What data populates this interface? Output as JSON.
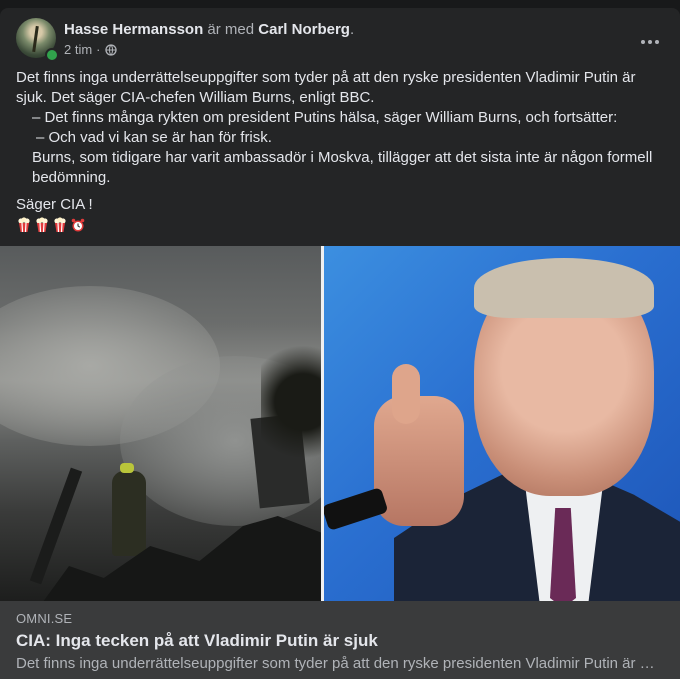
{
  "post": {
    "author": "Hasse Hermansson",
    "with_text": "är med",
    "tagged": "Carl Norberg",
    "tagged_suffix": ".",
    "time": "2 tim",
    "time_sep": "·",
    "privacy_icon": "globe-icon",
    "menu_icon": "more-options-icon",
    "text": {
      "line1": "Det finns inga underrättelseuppgifter som tyder på att den ryske presidenten Vladimir Putin är sjuk. Det säger CIA-chefen William Burns, enligt BBC.",
      "line2": "– Det finns många rykten om president Putins hälsa, säger William Burns, och fortsätter:",
      "line3": "– Och vad vi kan se är han för frisk.",
      "line4": "Burns, som tidigare har varit ambassadör i Moskva, tillägger att det sista inte är någon formell bedömning.",
      "line5": "Säger CIA !",
      "emojis": [
        "popcorn",
        "popcorn",
        "popcorn",
        "alarm-clock"
      ]
    }
  },
  "link_preview": {
    "domain": "OMNI.SE",
    "title": "CIA: Inga tecken på att Vladimir Putin är sjuk",
    "description": "Det finns inga underrättelseuppgifter som tyder på att den ryske presidenten Vladimir Putin är sjuk. Det säger CIA-chefen William Burns, enligt BBC."
  },
  "colors": {
    "card_bg": "#242526",
    "page_bg": "#18191a",
    "text_primary": "#e4e6eb",
    "text_secondary": "#b0b3b8",
    "online": "#31a24c"
  }
}
